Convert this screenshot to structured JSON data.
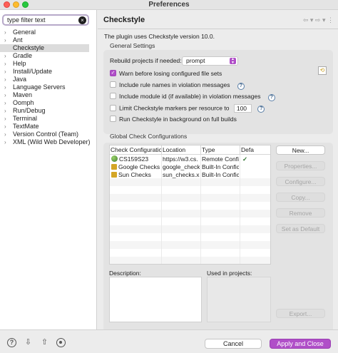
{
  "window": {
    "title": "Preferences"
  },
  "filter": {
    "placeholder": "type filter text",
    "clear_icon": "clear-icon"
  },
  "tree": {
    "items": [
      {
        "label": "General",
        "expandable": true
      },
      {
        "label": "Ant",
        "expandable": true
      },
      {
        "label": "Checkstyle",
        "expandable": false,
        "selected": true
      },
      {
        "label": "Gradle",
        "expandable": true
      },
      {
        "label": "Help",
        "expandable": true
      },
      {
        "label": "Install/Update",
        "expandable": true
      },
      {
        "label": "Java",
        "expandable": true
      },
      {
        "label": "Language Servers",
        "expandable": true
      },
      {
        "label": "Maven",
        "expandable": true
      },
      {
        "label": "Oomph",
        "expandable": true
      },
      {
        "label": "Run/Debug",
        "expandable": true
      },
      {
        "label": "Terminal",
        "expandable": true
      },
      {
        "label": "TextMate",
        "expandable": true
      },
      {
        "label": "Version Control (Team)",
        "expandable": true
      },
      {
        "label": "XML (Wild Web Developer)",
        "expandable": true
      }
    ]
  },
  "page": {
    "title": "Checkstyle",
    "info": "The plugin uses Checkstyle version 10.0.",
    "general_settings_label": "General Settings",
    "rebuild_label": "Rebuild projects if needed:",
    "rebuild_value": "prompt",
    "options": [
      {
        "label": "Warn before losing configured file sets",
        "checked": true
      },
      {
        "label": "Include rule names in violation messages",
        "checked": false
      },
      {
        "label": "Include module id (if available) in violation messages",
        "checked": false
      },
      {
        "label": "Limit Checkstyle markers per resource to",
        "checked": false
      },
      {
        "label": "Run Checkstyle in background on full builds",
        "checked": false
      }
    ],
    "limit_value": "100",
    "global_label": "Global Check Configurations"
  },
  "table": {
    "headers": [
      "Check Configuratio",
      "Location",
      "Type",
      "Defa"
    ],
    "rows": [
      {
        "name": "CS159S23",
        "location": "https://w3.cs.",
        "type": "Remote Confi",
        "default": "✓",
        "icon": "remote-config-icon"
      },
      {
        "name": "Google Checks",
        "location": "google_check",
        "type": "Built-In Confic",
        "default": "",
        "icon": "lock-icon"
      },
      {
        "name": "Sun Checks",
        "location": "sun_checks.x",
        "type": "Built-In Confic",
        "default": "",
        "icon": "lock-icon"
      }
    ]
  },
  "buttons": {
    "new": "New...",
    "properties": "Properties...",
    "configure": "Configure...",
    "copy": "Copy...",
    "remove": "Remove",
    "set_default": "Set as Default",
    "export": "Export..."
  },
  "description_label": "Description:",
  "used_label": "Used in projects:",
  "footer": {
    "cancel": "Cancel",
    "apply_close": "Apply and Close"
  },
  "colors": {
    "accent": "#b04fc8"
  }
}
